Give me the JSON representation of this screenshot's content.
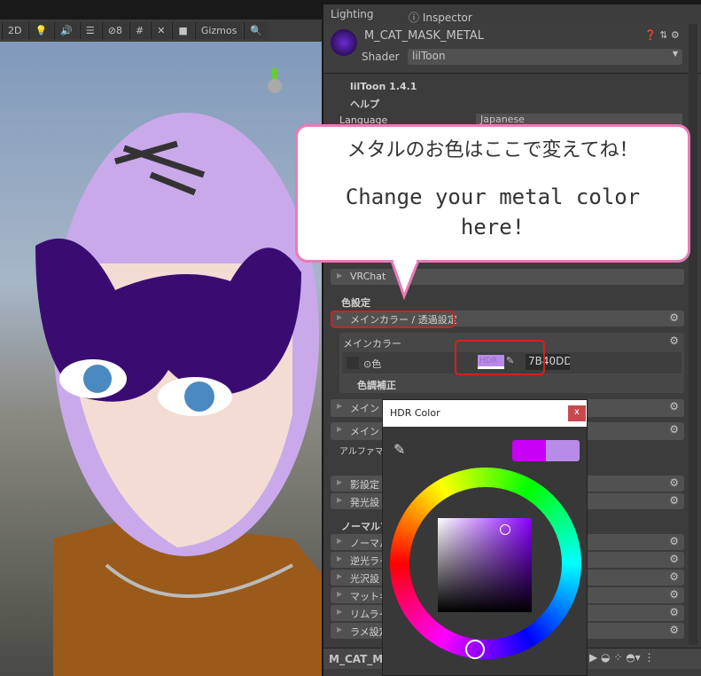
{
  "scene_toolbar": {
    "items": [
      "2D",
      "💡",
      "🔊",
      "☰",
      "⊘8",
      "#",
      "✕",
      "■",
      "Gizmos",
      "🔍"
    ]
  },
  "tabs": [
    {
      "label": "Lighting"
    },
    {
      "label": "Inspector"
    }
  ],
  "material": {
    "name": "M_CAT_MASK_METAL",
    "shader_label": "Shader",
    "shader_value": "lilToon"
  },
  "sections": {
    "version": "lilToon 1.4.1",
    "help": "ヘルプ",
    "language_label": "Language",
    "language_value": "Japanese",
    "vrchat": "VRChat",
    "color_header": "色設定",
    "main_color_group": "メインカラー / 透過設定",
    "main_color_sub": "メインカラー",
    "color_label": "⊙色",
    "hdr_label": "HDR",
    "hex_value": "7B40DD",
    "tone": "色調補正",
    "row_main2": "メイン",
    "row_main3": "メイン",
    "alpha_note": "アルファマスク… 明に変更する必要があります。",
    "shadow": "影設定",
    "emission": "発光設",
    "normal_header": "ノーマルマ",
    "rows": [
      "ノーマル",
      "逆光ライ",
      "光沢設",
      "マットキ",
      "リムライ",
      "ラメ設定"
    ]
  },
  "callout": {
    "jp": "メタルのお色はここで変えてね！",
    "en": "Change your metal color here!"
  },
  "popup": {
    "title": "HDR Color",
    "close": "x",
    "current_color": "#c800f5",
    "previous_color": "#b88be8"
  },
  "bottom": {
    "preview_name": "M_CAT_M"
  },
  "colors": {
    "accent": "#7b40dd",
    "highlight": "#d32020",
    "callout_border": "#e87bb5"
  }
}
